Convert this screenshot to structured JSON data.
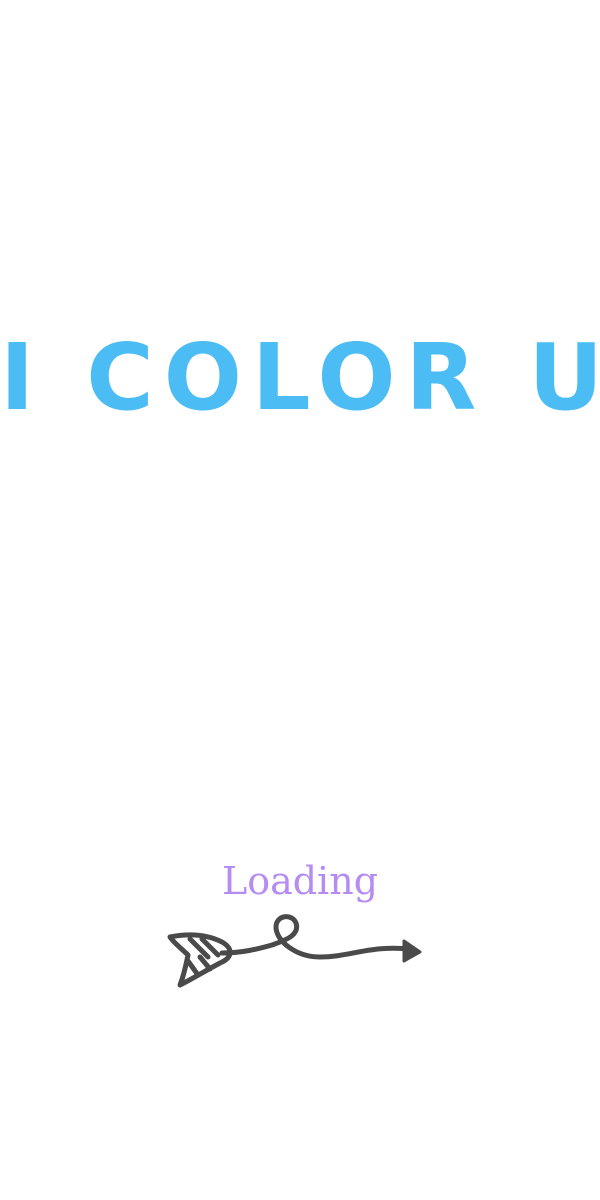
{
  "splash": {
    "app_title": "I COLOR U",
    "loading_label": "Loading",
    "title_color": "#4bbcf4",
    "loading_color": "#b48cf2",
    "arrow_icon": "decorative-arrow-icon",
    "arrow_color": "#4a4a4a"
  }
}
